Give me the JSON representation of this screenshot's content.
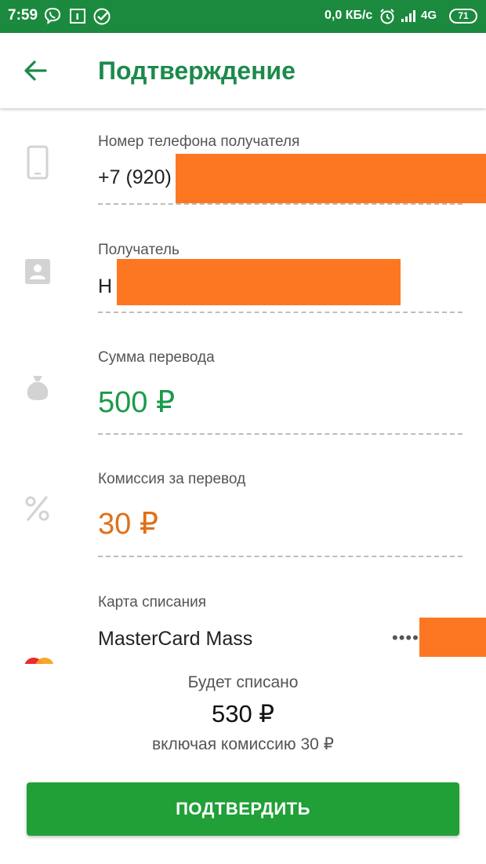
{
  "status_bar": {
    "time": "7:59",
    "network_speed": "0,0 КБ/с",
    "network_type": "4G",
    "battery": "71",
    "icons": [
      "viber-icon",
      "calendar-icon",
      "sberbank-icon",
      "alarm-icon",
      "signal-icon"
    ]
  },
  "app_bar": {
    "title": "Подтверждение",
    "back_icon": "arrow-left-icon"
  },
  "fields": {
    "phone": {
      "label": "Номер телефона получателя",
      "value": "+7 (920)",
      "icon": "phone-icon"
    },
    "recipient": {
      "label": "Получатель",
      "value": "Н",
      "icon": "contact-card-icon"
    },
    "amount": {
      "label": "Сумма перевода",
      "value": "500 ₽",
      "icon": "money-bag-icon"
    },
    "commission": {
      "label": "Комиссия за перевод",
      "value": "30 ₽",
      "icon": "percent-icon"
    },
    "card": {
      "label": "Карта списания",
      "value": "MasterCard Mass",
      "masked": "••••",
      "icon": "mastercard-icon"
    }
  },
  "summary": {
    "label": "Будет списано",
    "amount": "530 ₽",
    "note": "включая комиссию 30 ₽"
  },
  "confirm_button": "ПОДТВЕРДИТЬ",
  "colors": {
    "brand_green": "#1c8a4a",
    "status_bar": "#1b8a3e",
    "button_green": "#21a038",
    "amount_green": "#1c9a4b",
    "commission_orange": "#e07018",
    "redaction": "#fd7722"
  }
}
